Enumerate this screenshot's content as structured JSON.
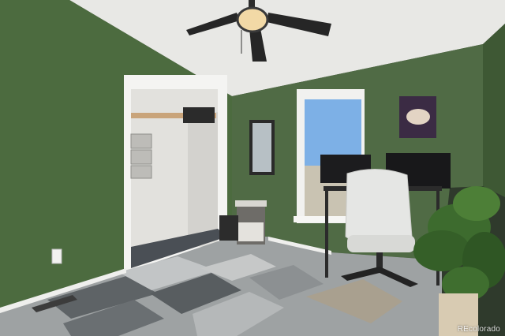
{
  "watermark": "REcolorado",
  "colors": {
    "wall_left": "#4c6b3f",
    "wall_back": "#4f6a44",
    "wall_right": "#3f5a35",
    "ceiling": "#e9e9e6",
    "trim": "#f2f2f0",
    "carpet_light": "#b9bcbc",
    "carpet_dark": "#5f6466",
    "sky": "#7fb1e6"
  }
}
